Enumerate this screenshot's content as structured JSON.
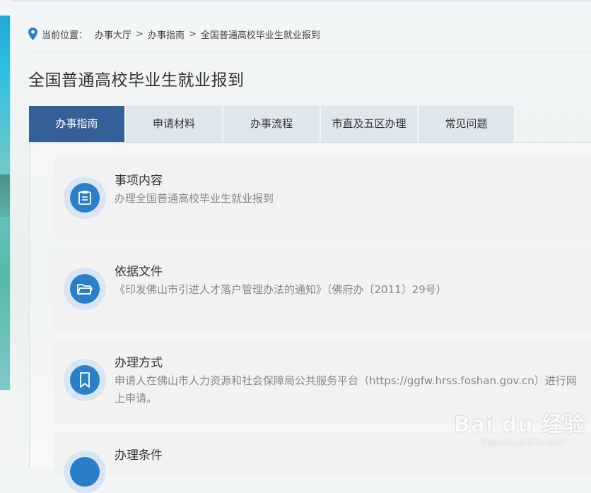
{
  "breadcrumb": {
    "label": "当前位置：",
    "items": [
      "办事大厅",
      "办事指南",
      "全国普通高校毕业生就业报到"
    ],
    "separator": ">"
  },
  "page": {
    "title": "全国普通高校毕业生就业报到"
  },
  "tabs": [
    {
      "label": "办事指南",
      "active": true
    },
    {
      "label": "申请材料",
      "active": false
    },
    {
      "label": "办事流程",
      "active": false
    },
    {
      "label": "市直及五区办理",
      "active": false
    },
    {
      "label": "常见问题",
      "active": false
    }
  ],
  "sections": [
    {
      "title": "事项内容",
      "text": "办理全国普通高校毕业生就业报到",
      "icon": "clipboard-icon"
    },
    {
      "title": "依据文件",
      "text": "《印发佛山市引进人才落户管理办法的通知》（佛府办〔2011〕29号）",
      "icon": "folder-icon"
    },
    {
      "title": "办理方式",
      "text": "申请人在佛山市人力资源和社会保障局公共服务平台（https://ggfw.hrss.foshan.gov.cn）进行网上申请。",
      "icon": "bookmark-icon"
    },
    {
      "title": "办理条件",
      "text": "",
      "icon": "circle-icon"
    }
  ],
  "watermark": {
    "main": "Bai du 经验",
    "sub": "jingyan.baidu.com"
  },
  "colors": {
    "tab_active_bg": "#355f98",
    "tab_bg": "#dfe6ec",
    "icon_blue": "#2b7fc9",
    "card_bg": "#f2f2f2"
  }
}
